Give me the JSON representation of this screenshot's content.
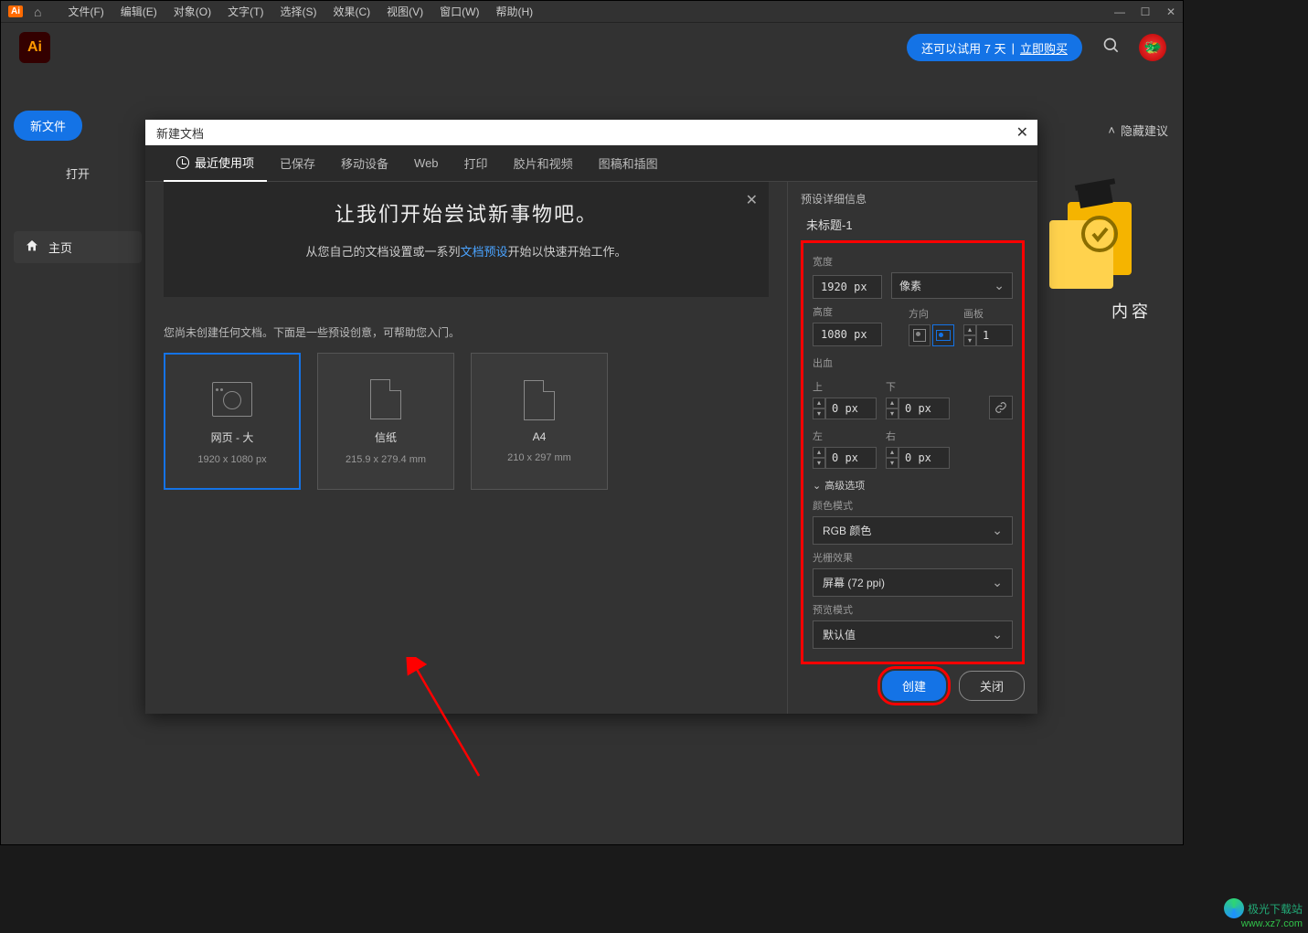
{
  "menubar": {
    "app_badge": "Ai",
    "items": [
      "文件(F)",
      "编辑(E)",
      "对象(O)",
      "文字(T)",
      "选择(S)",
      "效果(C)",
      "视图(V)",
      "窗口(W)",
      "帮助(H)"
    ]
  },
  "toolbar": {
    "logo": "Ai",
    "trial_text": "还可以试用 7 天",
    "trial_separator": "|",
    "buy_now": "立即购买"
  },
  "left": {
    "new_file": "新文件",
    "open": "打开",
    "home": "主页"
  },
  "right": {
    "hide_suggestions": "隐藏建议",
    "content_label": "内容"
  },
  "dialog": {
    "title": "新建文档",
    "tabs": [
      "最近使用项",
      "已保存",
      "移动设备",
      "Web",
      "打印",
      "胶片和视频",
      "图稿和插图"
    ],
    "banner_title": "让我们开始尝试新事物吧。",
    "banner_sub_prefix": "从您自己的文档设置或一系列",
    "banner_link": "文档预设",
    "banner_sub_suffix": "开始以快速开始工作。",
    "presets_help": "您尚未创建任何文档。下面是一些预设创意，可帮助您入门。",
    "presets": [
      {
        "name": "网页 - 大",
        "dim": "1920 x 1080 px",
        "selected": true,
        "type": "web"
      },
      {
        "name": "信纸",
        "dim": "215.9 x 279.4 mm",
        "selected": false,
        "type": "doc"
      },
      {
        "name": "A4",
        "dim": "210 x 297 mm",
        "selected": false,
        "type": "doc"
      }
    ],
    "details": {
      "heading": "预设详细信息",
      "doc_name": "未标题-1",
      "width_label": "宽度",
      "width_value": "1920 px",
      "unit": "像素",
      "height_label": "高度",
      "height_value": "1080 px",
      "orientation_label": "方向",
      "artboards_label": "画板",
      "artboards_value": "1",
      "bleed_label": "出血",
      "top_label": "上",
      "top_value": "0 px",
      "bottom_label": "下",
      "bottom_value": "0 px",
      "left_label": "左",
      "left_value": "0 px",
      "right_label": "右",
      "right_value": "0 px",
      "advanced": "高级选项",
      "color_mode_label": "颜色模式",
      "color_mode": "RGB 颜色",
      "raster_label": "光栅效果",
      "raster": "屏幕 (72 ppi)",
      "preview_label": "预览模式",
      "preview": "默认值"
    },
    "create_btn": "创建",
    "close_btn": "关闭"
  },
  "watermark": {
    "name": "极光下载站",
    "url": "www.xz7.com"
  }
}
